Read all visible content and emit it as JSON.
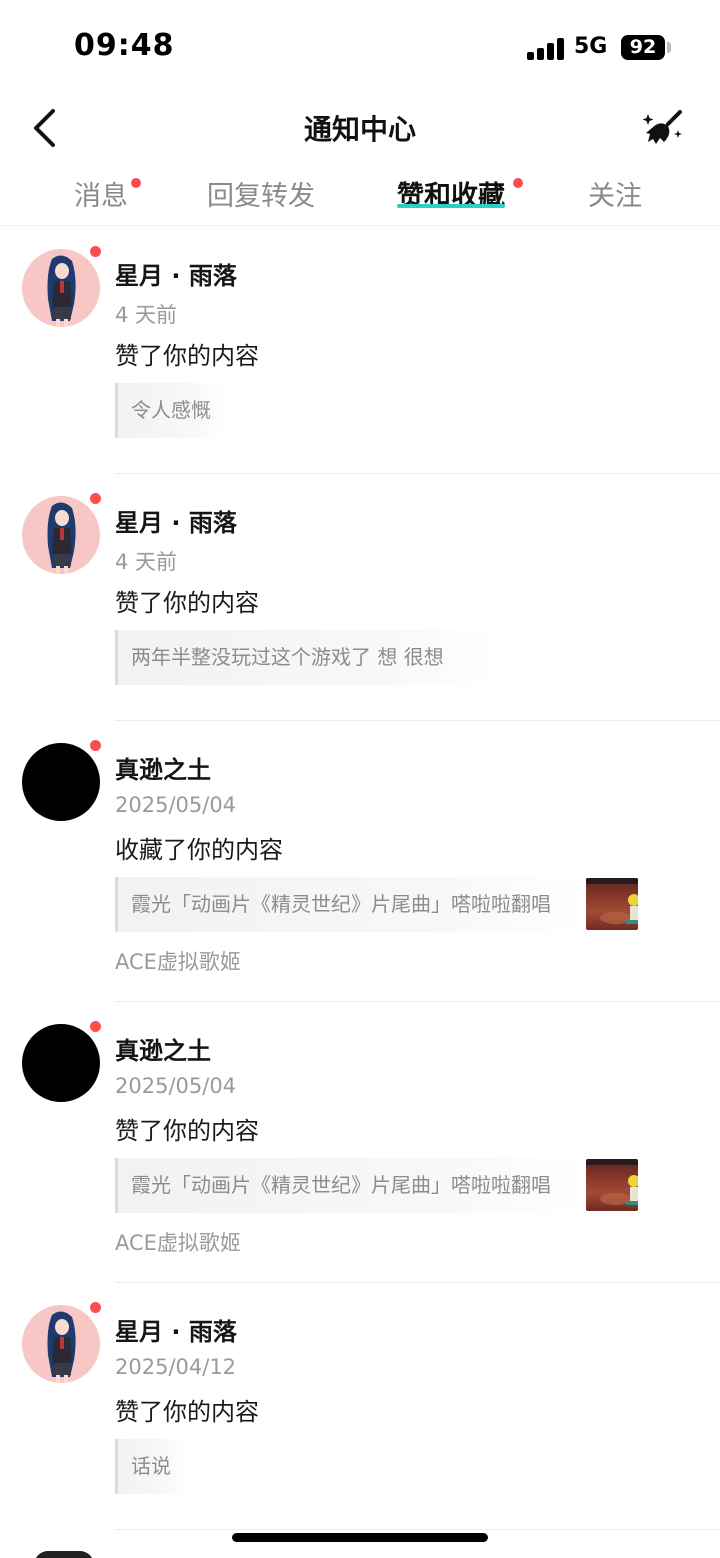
{
  "status_bar": {
    "time": "09:48",
    "network": "5G",
    "battery": "92"
  },
  "header": {
    "title": "通知中心"
  },
  "tabs": [
    {
      "label": "消息",
      "has_dot": true,
      "active": false
    },
    {
      "label": "回复转发",
      "has_dot": false,
      "active": false
    },
    {
      "label": "赞和收藏",
      "has_dot": true,
      "active": true
    },
    {
      "label": "关注",
      "has_dot": false,
      "active": false
    }
  ],
  "notifications": [
    {
      "user": "星月 · 雨落",
      "time": "4 天前",
      "action": "赞了你的内容",
      "quote": "令人感慨",
      "avatar": "anime-girl",
      "unread": true
    },
    {
      "user": "星月 · 雨落",
      "time": "4 天前",
      "action": "赞了你的内容",
      "quote": "两年半整没玩过这个游戏了 想 很想",
      "avatar": "anime-girl",
      "unread": true
    },
    {
      "user": "真逊之土",
      "time": "2025/05/04",
      "action": "收藏了你的内容",
      "quote": "霞光「动画片《精灵世纪》片尾曲」嗒啦啦翻唱",
      "source": "ACE虚拟歌姬",
      "avatar": "black",
      "unread": true
    },
    {
      "user": "真逊之土",
      "time": "2025/05/04",
      "action": "赞了你的内容",
      "quote": "霞光「动画片《精灵世纪》片尾曲」嗒啦啦翻唱",
      "source": "ACE虚拟歌姬",
      "avatar": "black",
      "unread": true
    },
    {
      "user": "星月 · 雨落",
      "time": "2025/04/12",
      "action": "赞了你的内容",
      "quote": "话说",
      "avatar": "anime-girl",
      "unread": true
    }
  ],
  "colors": {
    "accent_underline": "#29d0c5",
    "unread_dot": "#ff4d4f",
    "avatar_pink": "#f6c7c5"
  },
  "icons": {
    "back": "chevron-left-icon",
    "clean": "broom-sparkle-icon"
  }
}
